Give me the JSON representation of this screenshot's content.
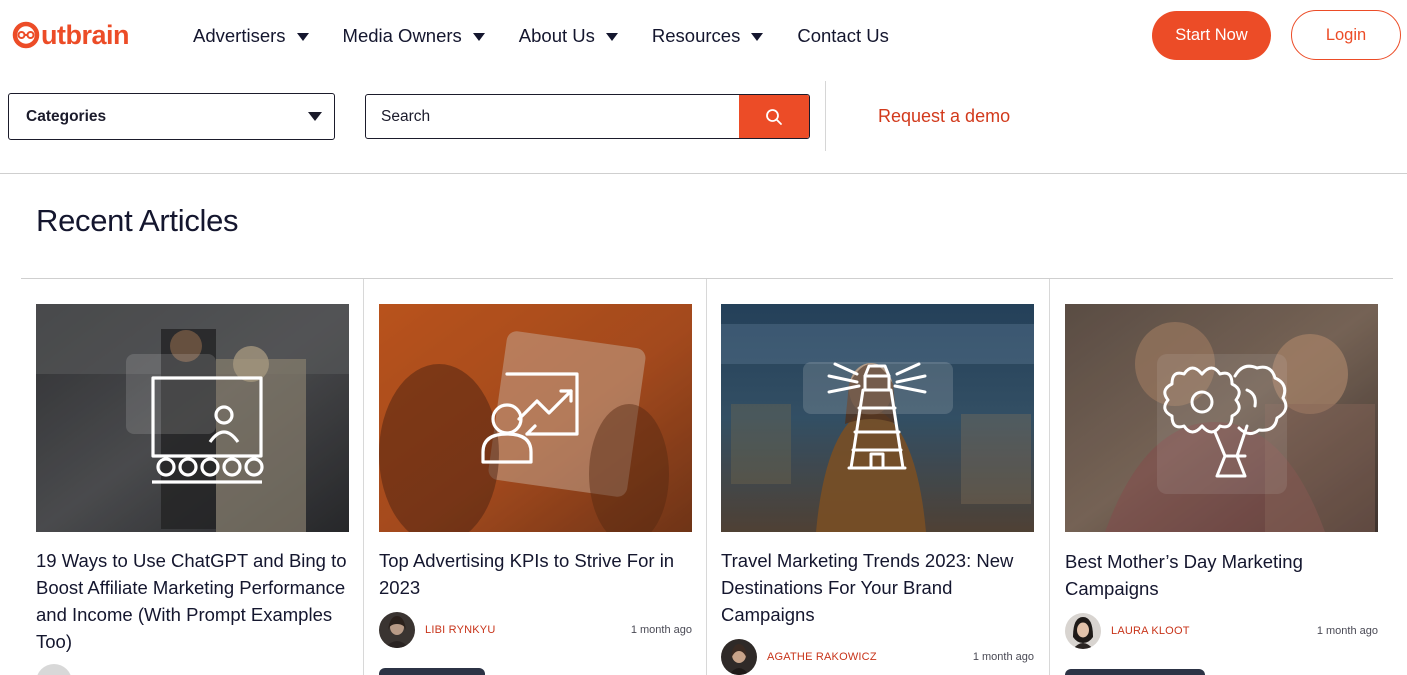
{
  "brand": {
    "logo_text": "utbrain",
    "accent": "#ec4c27",
    "dark": "#14162e"
  },
  "nav": {
    "items": [
      {
        "label": "Advertisers",
        "has_dropdown": true
      },
      {
        "label": "Media Owners",
        "has_dropdown": true
      },
      {
        "label": "About Us",
        "has_dropdown": true
      },
      {
        "label": "Resources",
        "has_dropdown": true
      },
      {
        "label": "Contact Us",
        "has_dropdown": false
      }
    ],
    "start_label": "Start Now",
    "login_label": "Login"
  },
  "filters": {
    "categories_label": "Categories",
    "search_placeholder": "Search",
    "demo_label": "Request a demo"
  },
  "section": {
    "title": "Recent Articles"
  },
  "articles": [
    {
      "title": "19 Ways to Use ChatGPT and Bing to Boost Affiliate Marketing Performance and Income (With Prompt Examples Too)",
      "icon": "presentation-icon",
      "author": "",
      "time": ""
    },
    {
      "title": "Top Advertising KPIs to Strive For in 2023",
      "icon": "growth-chart-icon",
      "author": "LIBI RYNKYU",
      "time": "1 month ago"
    },
    {
      "title": "Travel Marketing Trends 2023: New Destinations For Your Brand Campaigns",
      "icon": "lighthouse-icon",
      "author": "AGATHE RAKOWICZ",
      "time": "1 month ago"
    },
    {
      "title": "Best Mother’s Day Marketing Campaigns",
      "icon": "flower-bouquet-icon",
      "author": "LAURA KLOOT",
      "time": "1 month ago"
    }
  ]
}
